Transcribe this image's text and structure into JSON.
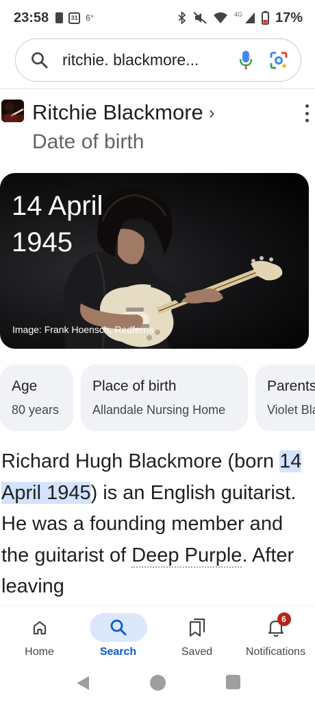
{
  "status_bar": {
    "time": "23:58",
    "calendar_day": "31",
    "temperature": "6°",
    "network": "4G",
    "battery": "17%",
    "icons": [
      "sim-alert-icon",
      "calendar-icon",
      "bluetooth-icon",
      "mute-icon",
      "wifi-icon",
      "signal-icon",
      "battery-icon"
    ]
  },
  "search": {
    "query": "ritchie. blackmore...",
    "icons": [
      "search-icon",
      "mic-icon",
      "lens-icon"
    ]
  },
  "knowledge_panel": {
    "title": "Ritchie Blackmore",
    "chevron": "›",
    "subtitle": "Date of birth",
    "answer_line1": "14 April",
    "answer_line2": "1945",
    "image_credit": "Image: Frank Hoensch, Redferns"
  },
  "attributes": [
    {
      "label": "Age",
      "value": "80 years"
    },
    {
      "label": "Place of birth",
      "value": "Allandale Nursing Home"
    },
    {
      "label": "Parents",
      "value": "Violet Blackmore"
    }
  ],
  "description": {
    "before": "Richard Hugh Blackmore (born ",
    "highlight": "14 April 1945",
    "middle": ") is an English guitarist. He was a founding member and the guitarist of ",
    "link": "Deep Purple",
    "after": ". After leaving"
  },
  "bottom_nav": [
    {
      "label": "Home",
      "icon": "home-icon",
      "active": false
    },
    {
      "label": "Search",
      "icon": "search-icon",
      "active": true
    },
    {
      "label": "Saved",
      "icon": "bookmark-icon",
      "active": false
    },
    {
      "label": "Notifications",
      "icon": "bell-icon",
      "active": false,
      "badge": "6"
    }
  ],
  "colors": {
    "accent": "#0b57d0",
    "active_pill": "#dbe7fb",
    "highlight": "#d3e3fd",
    "badge": "#b3261e",
    "chip_bg": "#f0f2f5"
  }
}
